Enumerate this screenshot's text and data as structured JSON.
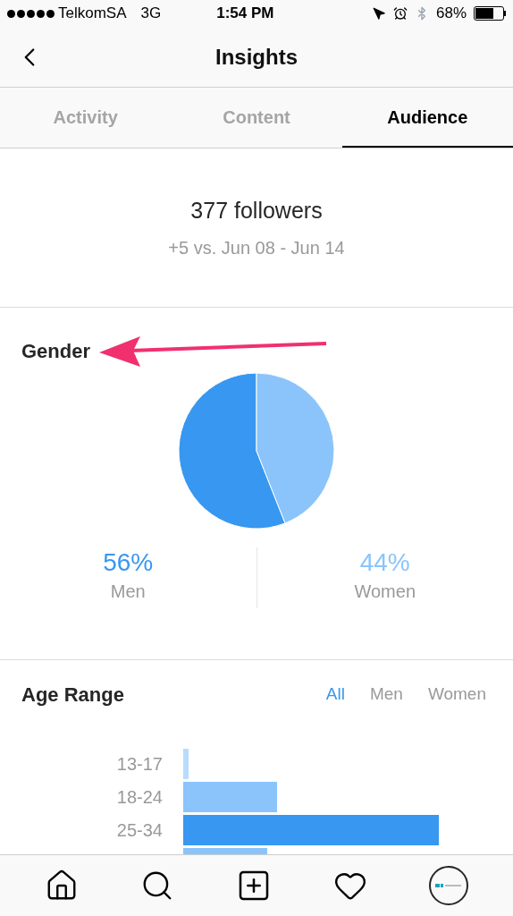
{
  "status_bar": {
    "carrier": "TelkomSA",
    "network": "3G",
    "time": "1:54 PM",
    "battery": "68%"
  },
  "header": {
    "title": "Insights"
  },
  "tabs": [
    {
      "label": "Activity",
      "selected": false
    },
    {
      "label": "Content",
      "selected": false
    },
    {
      "label": "Audience",
      "selected": true
    }
  ],
  "followers": {
    "count": "377 followers",
    "change": "+5 vs. Jun 08 - Jun 14"
  },
  "gender": {
    "chart_data": {
      "type": "pie",
      "title": "Gender",
      "categories": [
        "Men",
        "Women"
      ],
      "series": [
        {
          "values": [
            56,
            44
          ]
        }
      ],
      "value_labels": [
        "56%",
        "44%"
      ]
    },
    "legend": [
      {
        "color": "#3897f0"
      },
      {
        "color": "#8ac4fb"
      }
    ]
  },
  "age_range": {
    "title": "Age Range",
    "filters": [
      {
        "label": "All",
        "selected": true
      },
      {
        "label": "Men",
        "selected": false
      },
      {
        "label": "Women",
        "selected": false
      }
    ],
    "rows": [
      {
        "label": "13-17",
        "color": "#b8dcfd"
      },
      {
        "label": "18-24",
        "color": "#8ac4fb"
      },
      {
        "label": "25-34",
        "color": "#3897f0"
      }
    ]
  }
}
